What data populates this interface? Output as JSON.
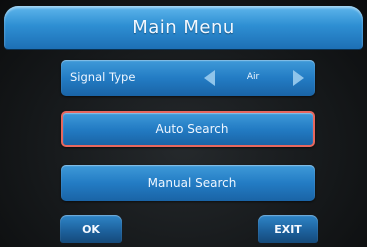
{
  "header": {
    "title": "Main Menu"
  },
  "signal_type": {
    "label": "Signal Type",
    "value": "Air",
    "left_icon": "arrow-left-icon",
    "right_icon": "arrow-right-icon"
  },
  "menu": {
    "auto_search": "Auto Search",
    "manual_search": "Manual Search",
    "selected": "Auto Search"
  },
  "footer": {
    "ok_label": "OK",
    "exit_label": "EXIT"
  },
  "colors": {
    "accent_blue": "#2e8fd3",
    "selection_border": "#e7675e",
    "background": "#16191b"
  }
}
